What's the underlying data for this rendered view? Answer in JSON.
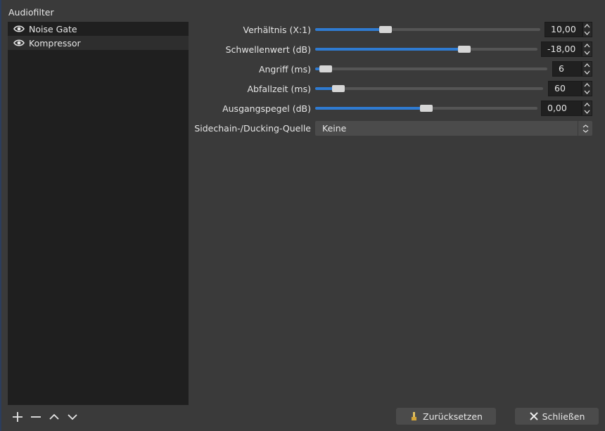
{
  "panel": {
    "title": "Audiofilter"
  },
  "filters": [
    {
      "name": "Noise Gate",
      "icon": "eye-icon"
    },
    {
      "name": "Kompressor",
      "icon": "eye-icon",
      "selected": true
    }
  ],
  "properties": {
    "ratio": {
      "label": "Verhältnis (X:1)",
      "value": "10,00",
      "level": 0.3
    },
    "threshold": {
      "label": "Schwellenwert (dB)",
      "value": "-18,00",
      "level": 0.68
    },
    "attack": {
      "label": "Angriff (ms)",
      "value": "6",
      "level": 0.02
    },
    "release": {
      "label": "Abfallzeit (ms)",
      "value": "60",
      "level": 0.08
    },
    "output_gain": {
      "label": "Ausgangspegel (dB)",
      "value": "0,00",
      "level": 0.5
    }
  },
  "sidechain": {
    "label": "Sidechain-/Ducking-Quelle",
    "value": "Keine"
  },
  "buttons": {
    "reset": "Zurücksetzen",
    "close": "Schließen"
  },
  "colors": {
    "accent": "#2f7bd1",
    "background": "#3a3a3a",
    "list_background": "#1f1f1f"
  }
}
